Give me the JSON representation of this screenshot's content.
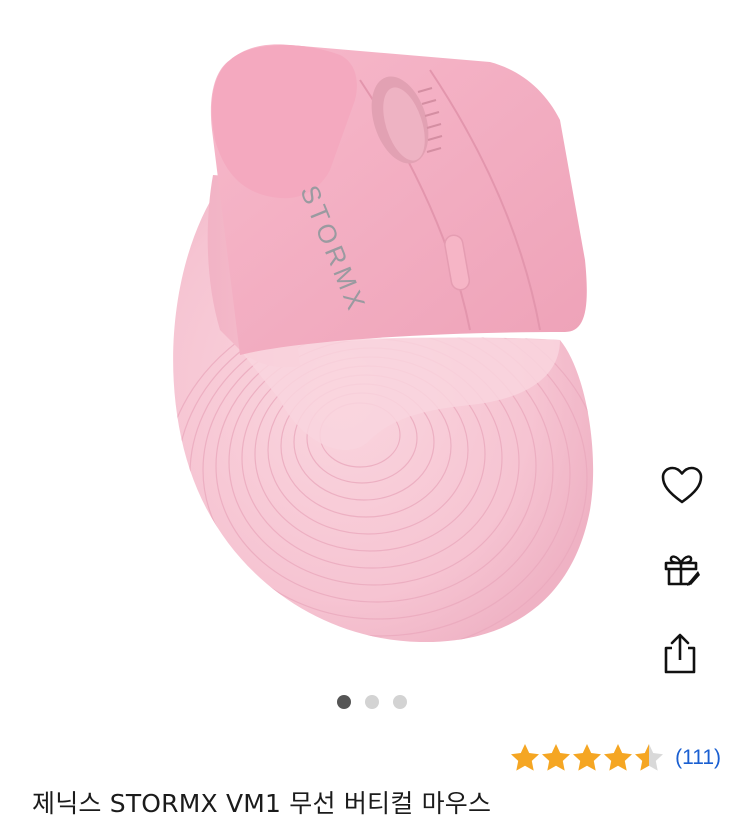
{
  "product": {
    "title": "제닉스 STORMX VM1 무선 버티컬 마우스",
    "rating": 4.5,
    "rating_max": 5,
    "review_count": "(111)",
    "brand_mark": "STORMX"
  },
  "carousel": {
    "total": 3,
    "active_index": 0
  },
  "actions": [
    {
      "id": "wishlist",
      "icon": "heart-icon"
    },
    {
      "id": "gift",
      "icon": "gift-icon"
    },
    {
      "id": "share",
      "icon": "share-icon"
    }
  ],
  "colors": {
    "star": "#f5a623",
    "star_empty": "#d9d9d9",
    "link": "#1a5fd1",
    "mouse_pink": "#f3b6c8",
    "mouse_light": "#f8ccd8"
  }
}
